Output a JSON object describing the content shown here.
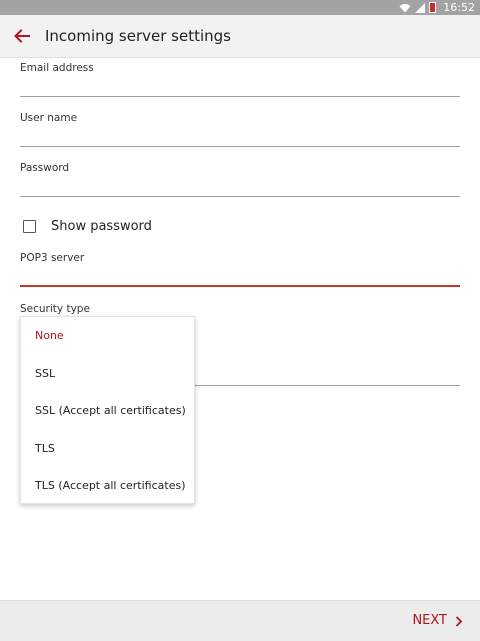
{
  "status_bar": {
    "time": "16:52",
    "icons": [
      "wifi-icon",
      "signal-icon",
      "battery-icon"
    ]
  },
  "header": {
    "back_icon": "arrow-back-icon",
    "title": "Incoming server settings"
  },
  "form": {
    "email_label": "Email address",
    "username_label": "User name",
    "password_label": "Password",
    "show_password_label": "Show password",
    "show_password_checked": false,
    "pop3_label": "POP3 server",
    "security_label": "Security type"
  },
  "security_dropdown": {
    "selected": "None",
    "options": [
      "None",
      "SSL",
      "SSL (Accept all certificates)",
      "TLS",
      "TLS (Accept all certificates)"
    ]
  },
  "footer": {
    "next_label": "NEXT"
  },
  "colors": {
    "accent": "#b0161f",
    "statusbar": "#a3a3a3",
    "appbar": "#f2f2f2",
    "footer": "#ececec"
  }
}
